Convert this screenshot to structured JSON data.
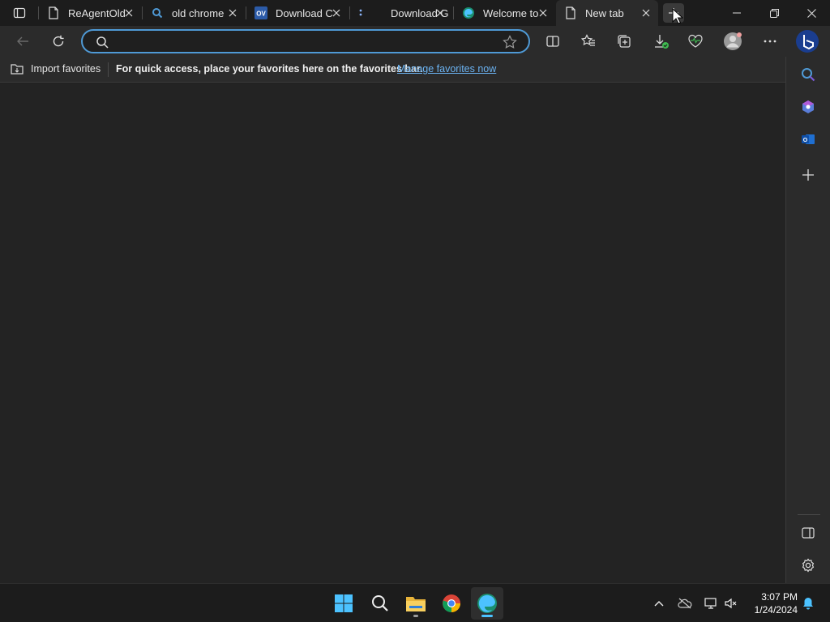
{
  "browser": {
    "tabs": [
      {
        "title": "ReAgentOld",
        "favicon": "page-icon",
        "active": false
      },
      {
        "title": "old chrome",
        "favicon": "search-icon",
        "active": false
      },
      {
        "title": "Download C",
        "favicon": "ov-logo-icon",
        "active": false
      },
      {
        "title": "Download G",
        "favicon": "dots-icon",
        "active": false
      },
      {
        "title": "Welcome to",
        "favicon": "edge-icon",
        "active": false
      },
      {
        "title": "New tab",
        "favicon": "page-icon",
        "active": true
      }
    ],
    "address_bar": {
      "value": "",
      "placeholder": ""
    },
    "favorites_bar": {
      "import_label": "Import favorites",
      "message": "For quick access, place your favorites here on the favorites bar.",
      "manage_link": "Manage favorites now"
    }
  },
  "taskbar": {
    "apps": [
      "windows-start-icon",
      "search-icon",
      "file-explorer-icon",
      "chrome-icon",
      "edge-icon"
    ],
    "clock": {
      "time": "3:07 PM",
      "date": "1/24/2024"
    }
  },
  "colors": {
    "accent": "#4f9ad6",
    "link": "#6bb3f2",
    "background": "#202020"
  }
}
